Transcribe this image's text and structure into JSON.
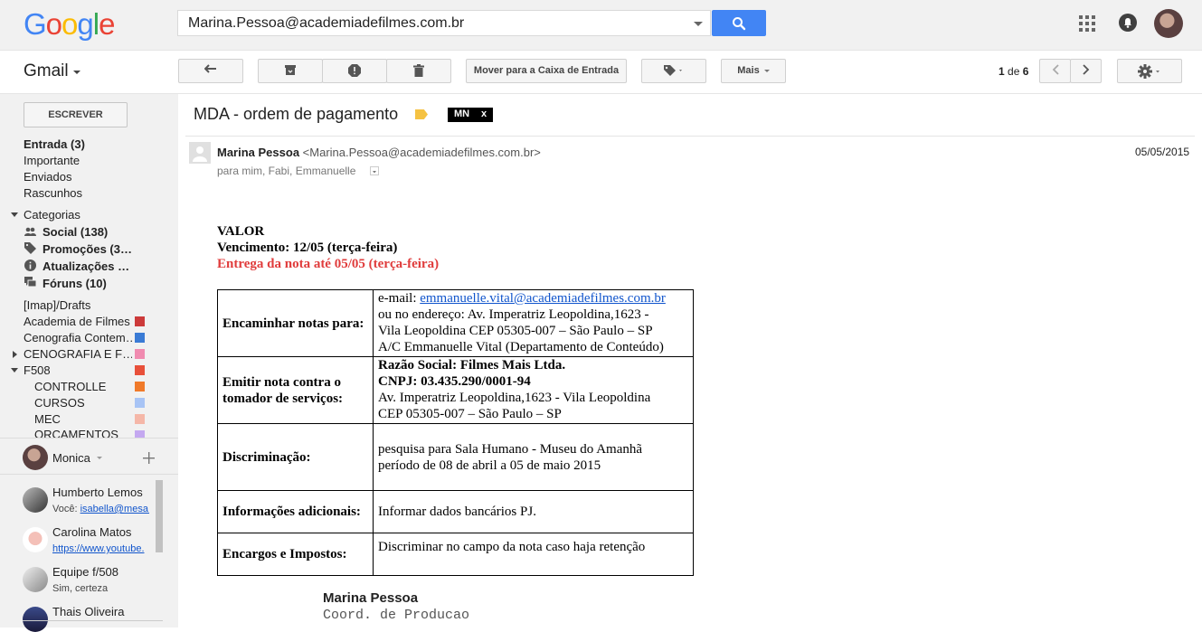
{
  "header": {
    "logo": "Google",
    "search_value": "Marina.Pessoa@academiadefilmes.com.br"
  },
  "toolbar": {
    "app_name": "Gmail",
    "move_to_inbox": "Mover para a Caixa de Entrada",
    "more": "Mais",
    "pager_current": "1",
    "pager_of": "de",
    "pager_total": "6"
  },
  "sidebar": {
    "compose": "ESCREVER",
    "items": [
      {
        "label": "Entrada (3)"
      },
      {
        "label": "Importante"
      },
      {
        "label": "Enviados"
      },
      {
        "label": "Rascunhos"
      },
      {
        "label": "Categorias"
      }
    ],
    "categories": [
      {
        "label": "Social (138)",
        "icon": "people-icon"
      },
      {
        "label": "Promoções (3…",
        "icon": "tag-icon"
      },
      {
        "label": "Atualizações (…",
        "icon": "info-icon"
      },
      {
        "label": "Fóruns (10)",
        "icon": "forum-icon"
      }
    ],
    "labels": [
      {
        "label": "[Imap]/Drafts",
        "color": ""
      },
      {
        "label": "Academia de Filmes",
        "color": "#cc3a3a"
      },
      {
        "label": "Cenografia Contem…",
        "color": "#3a7bd5"
      },
      {
        "label": "CENOGRAFIA E F…",
        "color": "#f08bb0"
      },
      {
        "label": "F508",
        "color": "#e8503a"
      }
    ],
    "f508_children": [
      {
        "label": "CONTROLLE",
        "color": "#f07a2a"
      },
      {
        "label": "CURSOS",
        "color": "#a8c4f5"
      },
      {
        "label": "MEC",
        "color": "#f5b7a8"
      },
      {
        "label": "ORCAMENTOS",
        "color": "#c4a8f0"
      }
    ]
  },
  "hangouts": {
    "me": "Monica",
    "contacts": [
      {
        "name": "Humberto Lemos",
        "sub_prefix": "Você: ",
        "sub_link": "isabella@mesa."
      },
      {
        "name": "Carolina Matos",
        "sub_prefix": "",
        "sub_link": "https://www.youtube."
      },
      {
        "name": "Equipe f/508",
        "sub_prefix": "Sim, certeza",
        "sub_link": ""
      },
      {
        "name": "Thais Oliveira",
        "sub_prefix": "",
        "sub_link": ""
      }
    ]
  },
  "email": {
    "subject": "MDA - ordem de pagamento",
    "label": "MN",
    "label_close": "x",
    "sender_name": "Marina Pessoa",
    "sender_addr": "<Marina.Pessoa@academiadefilmes.com.br>",
    "recipients": "para mim, Fabi, Emmanuelle",
    "date": "05/05/2015",
    "body": {
      "line1": "VALOR",
      "line2": "Vencimento: 12/05 (terça-feira)",
      "line3": "Entrega da nota até 05/05 (terça-feira)",
      "table": [
        {
          "header": "Encaminhar notas para:",
          "lines": [
            "ou no endereço: Av.  Imperatriz Leopoldina,1623 -",
            "Vila Leopoldina CEP 05305-007 – São Paulo – SP",
            "A/C Emmanuelle Vital (Departamento de Conteúdo)"
          ],
          "email_prefix": "e-mail: ",
          "email_link": "emmanuelle.vital@academiadefilmes.com.br"
        },
        {
          "header": "Emitir nota contra o tomador de serviços:",
          "bold_lines": [
            "Razão Social: Filmes Mais Ltda.",
            "CNPJ: 03.435.290/0001-94"
          ],
          "lines": [
            "Av. Imperatriz Leopoldina,1623 - Vila Leopoldina",
            "CEP 05305-007 – São Paulo – SP"
          ]
        },
        {
          "header": "Discriminação:",
          "lines": [
            "pesquisa para Sala Humano - Museu do Amanhã",
            "período de 08 de abril a 05 de maio 2015"
          ]
        },
        {
          "header": "Informações adicionais:",
          "lines": [
            "Informar dados bancários PJ."
          ]
        },
        {
          "header": "Encargos e Impostos:",
          "lines": [
            "Discriminar no campo da nota caso haja retenção"
          ]
        }
      ],
      "signature_name": "Marina Pessoa",
      "signature_role": "Coord. de Producao"
    }
  }
}
